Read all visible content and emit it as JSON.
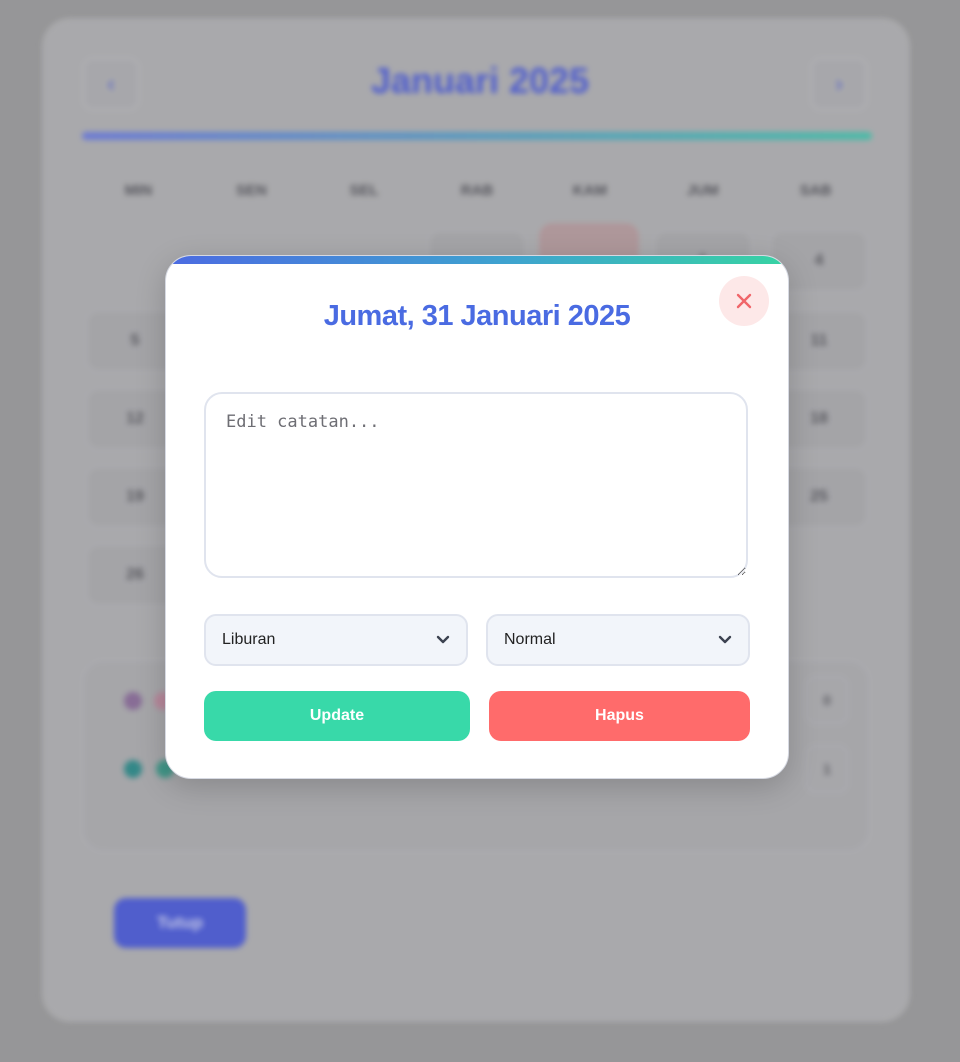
{
  "background": {
    "month_title": "Januari 2025",
    "prev_icon": "chevron-left-icon",
    "next_icon": "chevron-right-icon",
    "weekdays": [
      "MIN",
      "SEN",
      "SEL",
      "RAB",
      "KAM",
      "JUM",
      "SAB"
    ],
    "visible_days": [
      "1",
      "4",
      "5",
      "11",
      "12",
      "18",
      "19",
      "25",
      "26"
    ],
    "legend_counts": [
      "0",
      "1"
    ],
    "primary_button_label": "Tutup"
  },
  "modal": {
    "title": "Jumat, 31 Januari 2025",
    "close_icon": "close-icon",
    "close_color": "#f0666a",
    "note_placeholder": "Edit catatan...",
    "category_select": {
      "value": "Liburan",
      "icon": "chevron-down-icon"
    },
    "priority_select": {
      "value": "Normal",
      "icon": "chevron-down-icon"
    },
    "update_label": "Update",
    "delete_label": "Hapus",
    "colors": {
      "title": "#4a6be2",
      "update": "#38d9a9",
      "delete": "#ff6b6b"
    }
  }
}
